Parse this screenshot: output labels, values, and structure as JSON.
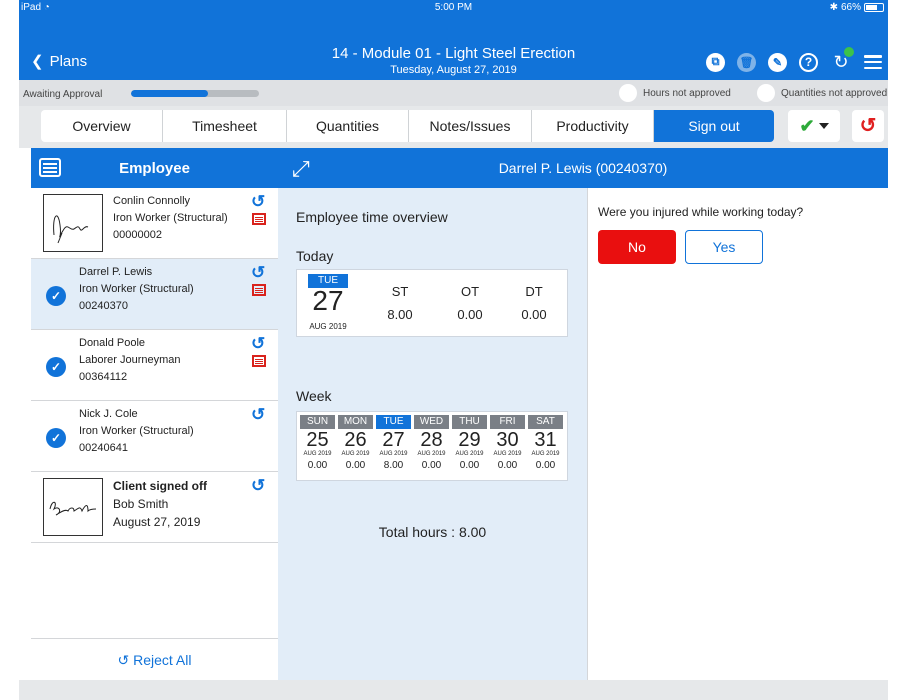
{
  "status_bar": {
    "device": "iPad",
    "time": "5:00 PM",
    "battery": "66%"
  },
  "header": {
    "back_label": "Plans",
    "title": "14 - Module 01 - Light Steel Erection",
    "date": "Tuesday, August 27, 2019"
  },
  "approval": {
    "label": "Awaiting Approval",
    "progress_fraction": 0.6,
    "hours_legend": "Hours not approved",
    "quantities_legend": "Quantities not approved"
  },
  "tabs": [
    {
      "label": "Overview"
    },
    {
      "label": "Timesheet"
    },
    {
      "label": "Quantities"
    },
    {
      "label": "Notes/Issues"
    },
    {
      "label": "Productivity"
    },
    {
      "label": "Sign out"
    }
  ],
  "left_panel": {
    "title": "Employee",
    "reject_all": "Reject All",
    "employees": [
      {
        "name": "Conlin Connolly",
        "role": "Iron Worker (Structural)",
        "id": "00000002"
      },
      {
        "name": "Darrel P. Lewis",
        "role": "Iron Worker (Structural)",
        "id": "00240370"
      },
      {
        "name": "Donald Poole",
        "role": "Laborer Journeyman",
        "id": "00364112"
      },
      {
        "name": "Nick J. Cole",
        "role": "Iron Worker (Structural)",
        "id": "00240641"
      }
    ],
    "client": {
      "status": "Client signed off",
      "name": "Bob Smith",
      "date": "August 27, 2019"
    }
  },
  "detail": {
    "header_name": "Darrel P. Lewis (00240370)",
    "overview_title": "Employee time overview",
    "today_label": "Today",
    "today": {
      "day": "TUE",
      "date": "27",
      "month": "AUG 2019",
      "columns": [
        {
          "label": "ST",
          "value": "8.00"
        },
        {
          "label": "OT",
          "value": "0.00"
        },
        {
          "label": "DT",
          "value": "0.00"
        }
      ]
    },
    "week_label": "Week",
    "week": [
      {
        "day": "SUN",
        "date": "25",
        "month": "AUG 2019",
        "hours": "0.00"
      },
      {
        "day": "MON",
        "date": "26",
        "month": "AUG 2019",
        "hours": "0.00"
      },
      {
        "day": "TUE",
        "date": "27",
        "month": "AUG 2019",
        "hours": "8.00"
      },
      {
        "day": "WED",
        "date": "28",
        "month": "AUG 2019",
        "hours": "0.00"
      },
      {
        "day": "THU",
        "date": "29",
        "month": "AUG 2019",
        "hours": "0.00"
      },
      {
        "day": "FRI",
        "date": "30",
        "month": "AUG 2019",
        "hours": "0.00"
      },
      {
        "day": "SAT",
        "date": "31",
        "month": "AUG 2019",
        "hours": "0.00"
      }
    ],
    "total": "Total hours : 8.00",
    "injury_question": "Were you injured while working today?",
    "no_label": "No",
    "yes_label": "Yes"
  },
  "colors": {
    "accent": "#1173d9",
    "danger": "#e90f0f",
    "success": "#2eaa3a"
  }
}
